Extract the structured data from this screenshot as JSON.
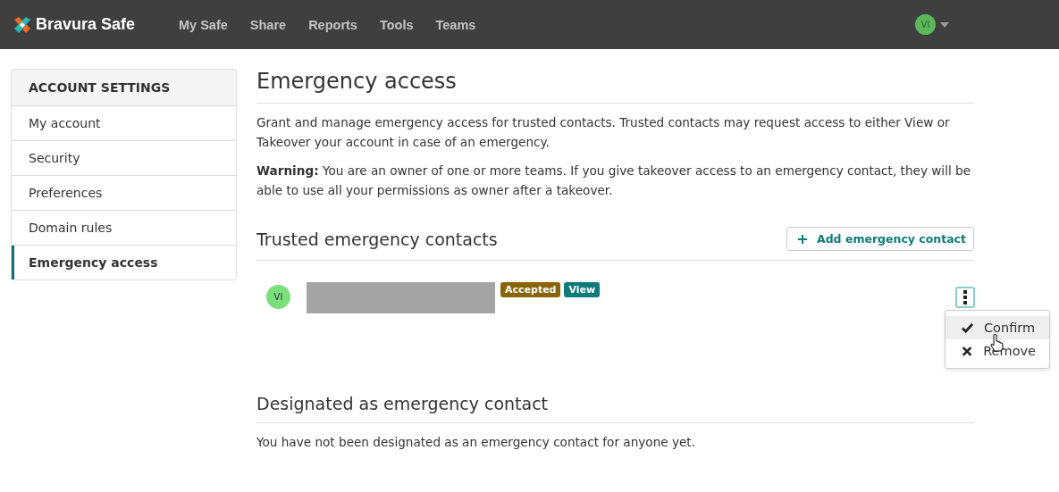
{
  "navbar": {
    "brand": "Bravura Safe",
    "links": [
      {
        "label": "My Safe"
      },
      {
        "label": "Share"
      },
      {
        "label": "Reports"
      },
      {
        "label": "Tools"
      },
      {
        "label": "Teams"
      }
    ],
    "user_avatar": "VI"
  },
  "sidebar": {
    "heading": "ACCOUNT SETTINGS",
    "items": [
      {
        "label": "My account",
        "selected": false
      },
      {
        "label": "Security",
        "selected": false
      },
      {
        "label": "Preferences",
        "selected": false
      },
      {
        "label": "Domain rules",
        "selected": false
      },
      {
        "label": "Emergency access",
        "selected": true
      }
    ]
  },
  "page": {
    "title": "Emergency access",
    "intro": "Grant and manage emergency access for trusted contacts. Trusted contacts may request access to either View or Takeover your account in case of an emergency.",
    "warning": "**Warning:** You are an owner of one or more teams. If you give takeover access to an emergency contact, they will be able to use all your permissions as owner after a takeover."
  },
  "trusted": {
    "heading": "Trusted emergency contacts",
    "add_button": "Add emergency contact",
    "contacts": [
      {
        "avatar": "VI",
        "badges": [
          {
            "label": "Accepted",
            "color": "#8a6508"
          },
          {
            "label": "View",
            "color": "#0f7a7a"
          }
        ],
        "menu": [
          {
            "label": "Confirm",
            "kind": "confirm",
            "hovered": true
          },
          {
            "label": "Remove",
            "kind": "remove",
            "hovered": false
          }
        ]
      }
    ]
  },
  "designated": {
    "heading": "Designated as emergency contact",
    "message": "You have not been designated as an emergency contact for anyone yet."
  }
}
